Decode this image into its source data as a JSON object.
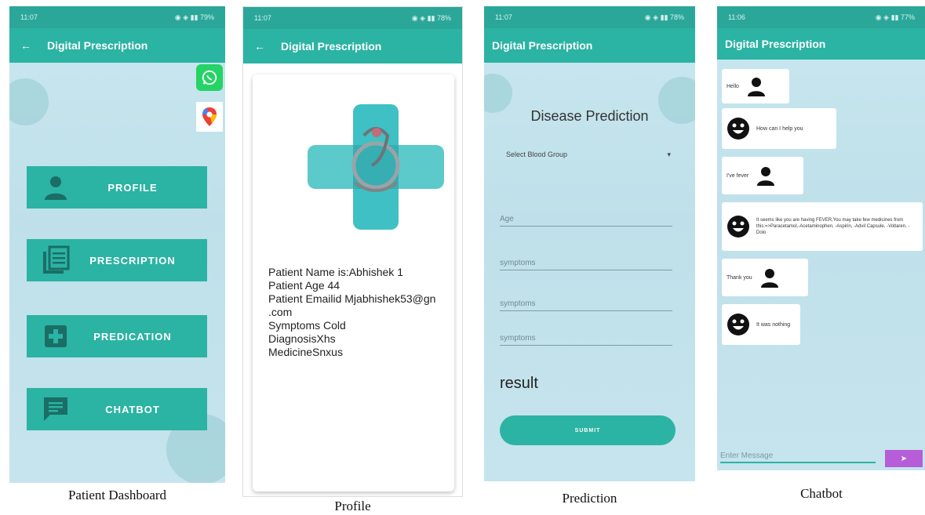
{
  "status_time": [
    "11:07",
    "11:07",
    "11:07",
    "11:06"
  ],
  "status_right": [
    "◉ ◈ ▮▮ 79%",
    "◉ ◈ ▮▮ 78%",
    "◉ ◈ ▮▮ 78%",
    "◉ ◈ ▮▮ 77%"
  ],
  "app_title": "Digital Prescription",
  "dashboard": {
    "caption": "Patient Dashboard",
    "buttons": [
      {
        "label": "PROFILE"
      },
      {
        "label": "PRESCRIPTION"
      },
      {
        "label": "PREDICATION"
      },
      {
        "label": "CHATBOT"
      }
    ]
  },
  "profile": {
    "caption": "Profile",
    "lines": [
      "Patient Name is:Abhishek 1",
      "Patient Age 44",
      "Patient Emailid Mjabhishek53@gn",
      ".com",
      "Symptoms Cold",
      "DiagnosisXhs",
      "MedicineSnxus"
    ]
  },
  "prediction": {
    "caption": "Prediction",
    "heading": "Disease Prediction",
    "blood_group": "Select Blood Group",
    "fields": [
      "Age",
      "symptoms",
      "symptoms",
      "symptoms"
    ],
    "result": "result",
    "submit": "SUBMIT"
  },
  "chatbot": {
    "caption": "Chatbot",
    "messages": [
      {
        "from": "user",
        "text": "Hello"
      },
      {
        "from": "bot",
        "text": "How can I help you"
      },
      {
        "from": "user",
        "text": "I've fever"
      },
      {
        "from": "bot",
        "text": "It seems like you are having FEVER,You may take few medicines from this:=>Paracetamol,-Acetaminophen, -Aspirin, -Advil Capsule, -Voltaren, -Dolo"
      },
      {
        "from": "user",
        "text": "Thank you"
      },
      {
        "from": "bot",
        "text": "It was nothing"
      }
    ],
    "input_placeholder": "Enter Message",
    "send_label": "➤"
  }
}
